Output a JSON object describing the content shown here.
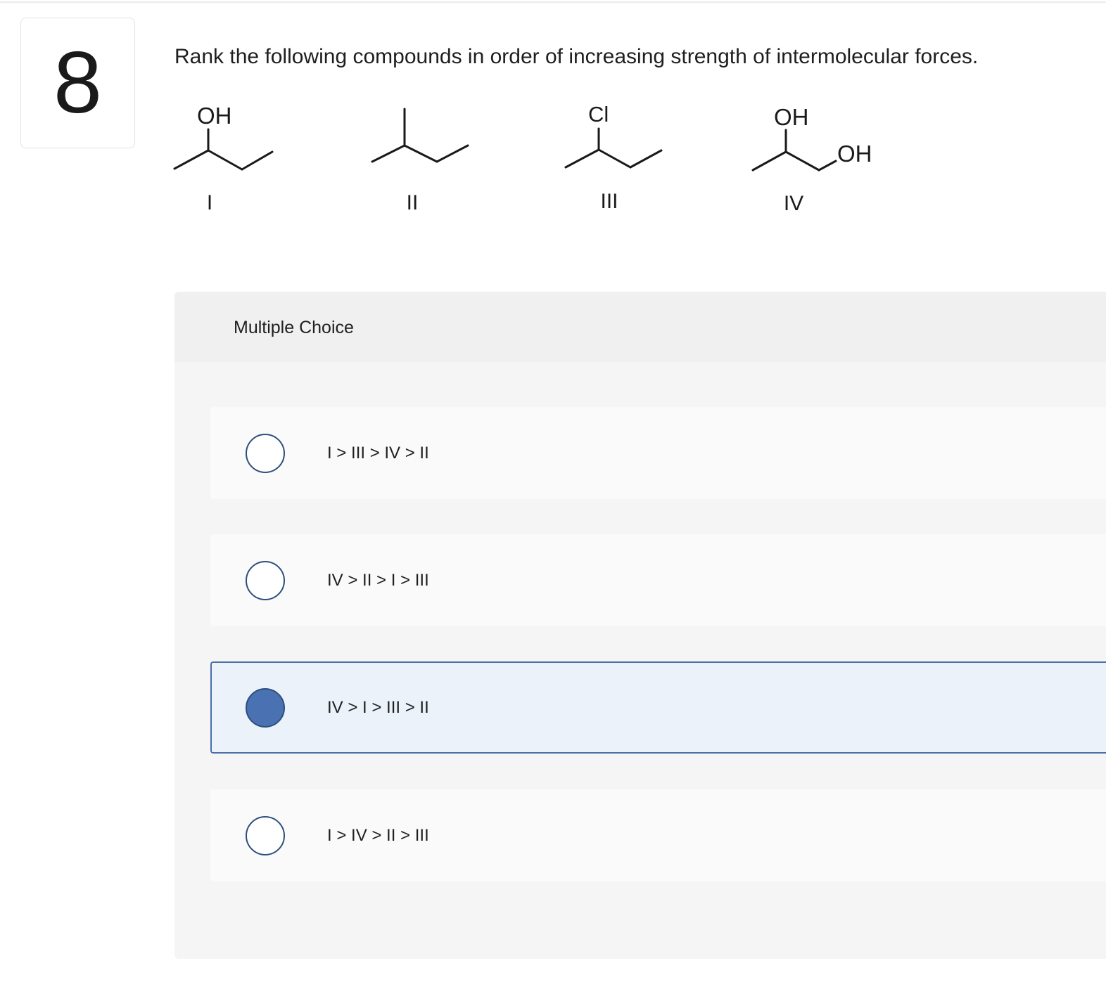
{
  "question": {
    "number": "8",
    "prompt": "Rank the following compounds in order of increasing strength of intermolecular forces."
  },
  "compounds": [
    {
      "label": "I",
      "substituent": "OH"
    },
    {
      "label": "II"
    },
    {
      "label": "III",
      "substituent": "Cl"
    },
    {
      "label": "IV",
      "substituent": "OH",
      "substituent2": "OH"
    }
  ],
  "multiple_choice": {
    "header": "Multiple Choice",
    "options": [
      {
        "label": "I > III > IV > II",
        "selected": false
      },
      {
        "label": "IV > II > I > III",
        "selected": false
      },
      {
        "label": "IV > I > III > II",
        "selected": true
      },
      {
        "label": "I > IV > II > III",
        "selected": false
      }
    ]
  },
  "colors": {
    "selected_fill": "#4a72b2",
    "selected_border": "#4a6fa9",
    "selected_bg": "#ebf2fa",
    "radio_border": "#2d4f7c"
  }
}
